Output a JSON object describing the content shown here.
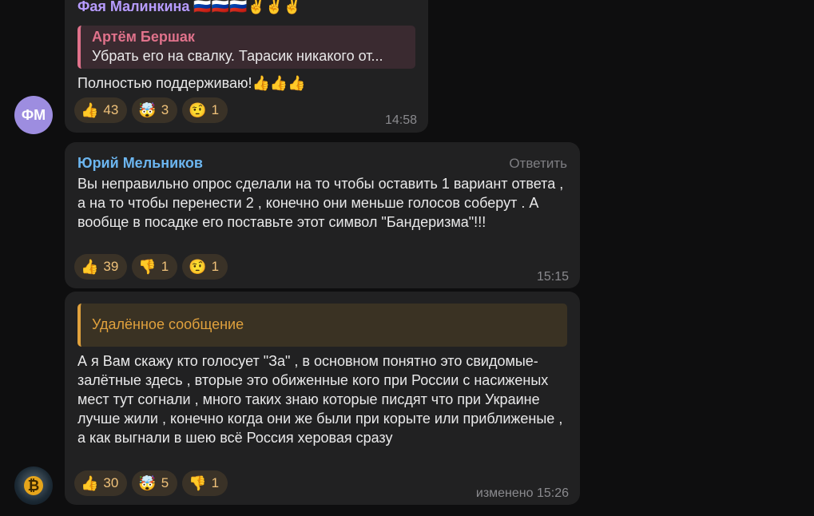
{
  "messages": [
    {
      "author": "Фая Малинкина 🇷🇺🇷🇺🇷🇺✌️✌️✌️",
      "author_color": "#b79cff",
      "quote": {
        "author": "Артём Бершак",
        "text": "Убрать его на свалку. Тарасик никакого от...",
        "color": "#e0728b"
      },
      "text": "Полностью поддерживаю!👍👍👍",
      "reactions": [
        {
          "icon": "thumbs-up-icon",
          "emoji": "👍",
          "count": "43"
        },
        {
          "icon": "mind-blown-icon",
          "emoji": "🤯",
          "count": "3"
        },
        {
          "icon": "raised-eyebrow-icon",
          "emoji": "🤨",
          "count": "1"
        }
      ],
      "time": "14:58",
      "avatar_initials": "ФМ"
    },
    {
      "author": "Юрий Мельников",
      "author_color": "#6cb6f0",
      "reply_label": "Ответить",
      "text": "Вы неправильно опрос сделали на то чтобы оставить 1 вариант ответа , а на то чтобы перенести 2 , конечно они меньше голосов соберут . А вообще в посадке его поставьте этот символ \"Бандеризма\"!!!",
      "reactions": [
        {
          "icon": "thumbs-up-icon",
          "emoji": "👍",
          "count": "39"
        },
        {
          "icon": "thumbs-down-icon",
          "emoji": "👎",
          "count": "1"
        },
        {
          "icon": "raised-eyebrow-icon",
          "emoji": "🤨",
          "count": "1"
        }
      ],
      "time": "15:15"
    },
    {
      "quote": {
        "text": "Удалённое сообщение",
        "color": "#e0a13d"
      },
      "text": "А я Вам скажу кто голосует \"За\" , в основном понятно это свидомые-залётные здесь , вторые это обиженные кого при России с насиженых мест тут согнали , много таких знаю которые писдят что при Украине лучше жили , конечно когда они же были при корыте или приближеные , а как выгнали в шею всё Россия херовая сразу",
      "reactions": [
        {
          "icon": "thumbs-up-icon",
          "emoji": "👍",
          "count": "30"
        },
        {
          "icon": "mind-blown-icon",
          "emoji": "🤯",
          "count": "5"
        },
        {
          "icon": "thumbs-down-icon",
          "emoji": "👎",
          "count": "1"
        }
      ],
      "time": "изменено 15:26",
      "avatar_emblem": "₿"
    }
  ]
}
